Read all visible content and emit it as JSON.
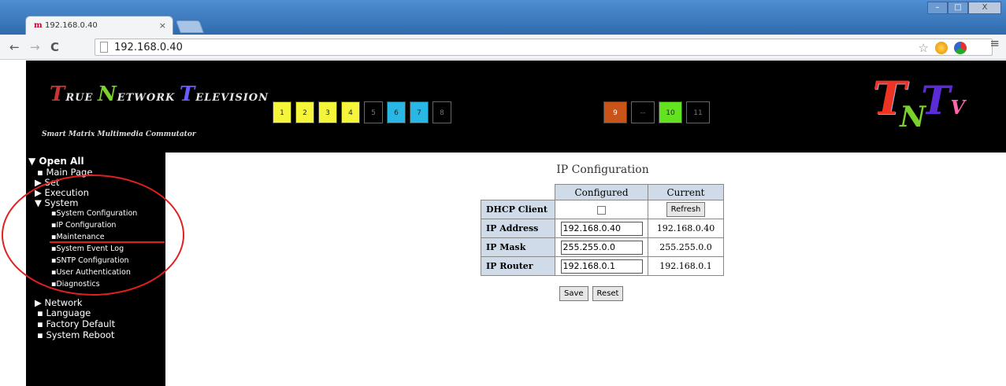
{
  "browser": {
    "tab_title": "192.168.0.40",
    "tab_favicon": "m",
    "tab_close": "×",
    "address": "192.168.0.40",
    "window_buttons": [
      "–",
      "□",
      "X"
    ]
  },
  "header": {
    "logo": {
      "letter1": "T",
      "word1": "RUE ",
      "letter2": "N",
      "word2": "ETWORK ",
      "letter3": "T",
      "word3": "ELEVISION"
    },
    "subtitle": "Smart Matrix Multimedia Commutator",
    "channels_a": [
      "1",
      "2",
      "3",
      "4",
      "5",
      "6",
      "7",
      "8"
    ],
    "channels_b": [
      "9",
      "--",
      "10",
      "11"
    ],
    "brand": {
      "t1": "T",
      "n": "N",
      "t2": "T",
      "v": "V"
    }
  },
  "sidebar": {
    "open_all": "Open All",
    "items": [
      {
        "label": "Main Page",
        "bullet": "▪"
      },
      {
        "label": "Set",
        "bullet": "▶"
      },
      {
        "label": "Execution",
        "bullet": "▶"
      },
      {
        "label": "System",
        "bullet": "▼"
      }
    ],
    "system_children": [
      "System Configuration",
      "IP Configuration",
      "Maintenance",
      "System Event Log",
      "SNTP Configuration",
      "User Authentication",
      "Diagnostics"
    ],
    "after": [
      {
        "label": "Network",
        "bullet": "▶"
      },
      {
        "label": "Language",
        "bullet": "▪"
      },
      {
        "label": "Factory Default",
        "bullet": "▪"
      },
      {
        "label": "System Reboot",
        "bullet": "▪"
      }
    ]
  },
  "main": {
    "title": "IP Configuration",
    "col_configured": "Configured",
    "col_current": "Current",
    "rows": {
      "dhcp": {
        "label": "DHCP Client",
        "current_button": "Refresh"
      },
      "address": {
        "label": "IP Address",
        "configured": "192.168.0.40",
        "current": "192.168.0.40"
      },
      "mask": {
        "label": "IP Mask",
        "configured": "255.255.0.0",
        "current": "255.255.0.0"
      },
      "router": {
        "label": "IP Router",
        "configured": "192.168.0.1",
        "current": "192.168.0.1"
      }
    },
    "save": "Save",
    "reset": "Reset"
  }
}
